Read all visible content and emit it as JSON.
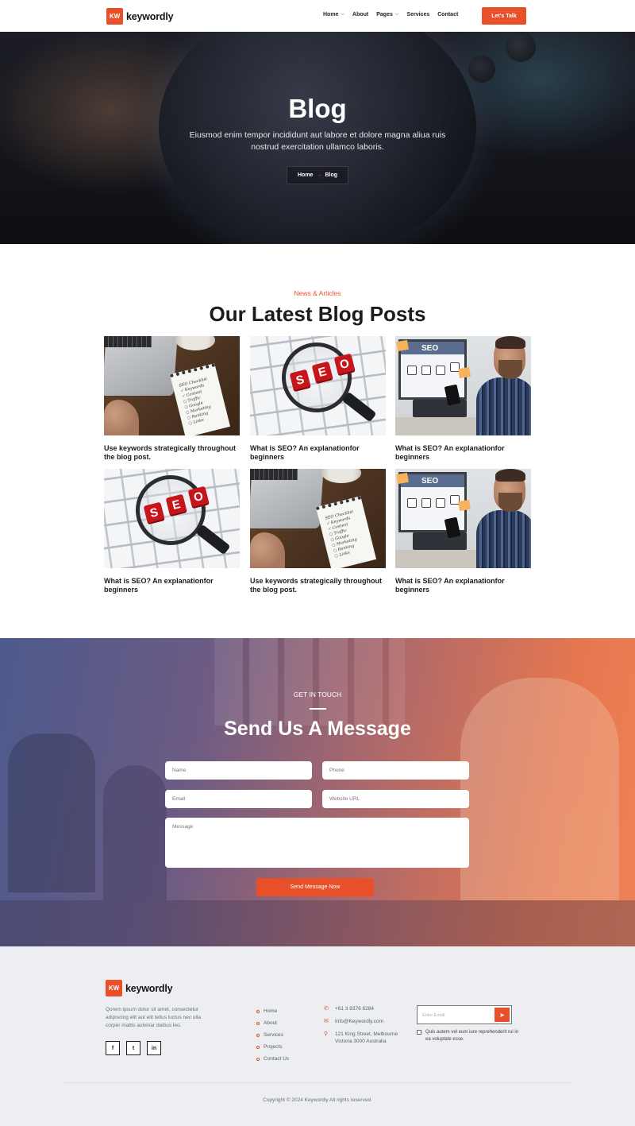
{
  "brand": {
    "mark": "KW",
    "name": "keywordly",
    "accent": "#e8502a"
  },
  "nav": {
    "items": [
      {
        "label": "Home",
        "dropdown": true
      },
      {
        "label": "About",
        "dropdown": false
      },
      {
        "label": "Pages",
        "dropdown": true
      },
      {
        "label": "Services",
        "dropdown": false
      },
      {
        "label": "Contact",
        "dropdown": false
      }
    ],
    "cta": "Let's Talk"
  },
  "hero": {
    "title": "Blog",
    "subtitle": "Eiusmod enim tempor incididunt aut labore et dolore magna aliua ruis nostrud exercitation ullamco laboris.",
    "breadcrumb": {
      "home": "Home",
      "arrow": "→",
      "current": "Blog"
    }
  },
  "blog": {
    "eyebrow": "News & Articles",
    "title": "Our Latest Blog Posts",
    "posts": [
      {
        "image": "laptop-checklist",
        "title": "Use keywords strategically throughout the blog post."
      },
      {
        "image": "seo-magnifier",
        "title": "What is SEO? An explanationfor beginners"
      },
      {
        "image": "man-seo-screen",
        "title": "What is SEO? An explanationfor beginners"
      },
      {
        "image": "seo-magnifier",
        "title": "What is SEO? An explanationfor beginners"
      },
      {
        "image": "laptop-checklist",
        "title": "Use keywords strategically throughout the blog post."
      },
      {
        "image": "man-seo-screen",
        "title": "What is SEO? An explanationfor beginners"
      }
    ],
    "image_text": {
      "seo_letters": [
        "S",
        "E",
        "O"
      ],
      "checklist": [
        "SEO Checklist",
        "✓ Keywords",
        "✓ Content",
        "○ Traffic",
        "○ Google",
        "○ Marketing",
        "○ Ranking",
        "○ Links"
      ],
      "screen_label": "SEO"
    }
  },
  "contact": {
    "eyebrow": "GET IN TOUCH",
    "title": "Send Us A Message",
    "fields": {
      "name": "Name",
      "phone": "Phone",
      "email": "Email",
      "website": "Website URL",
      "message": "Message"
    },
    "submit": "Send Message Now"
  },
  "footer": {
    "about": "Qorem ipsum dolor sit amet, consectetur adipiscing elit aut elit tellus luctus nec ulla corper mattis aulvinar daibus leo.",
    "socials": [
      {
        "icon": "facebook-icon",
        "glyph": "f"
      },
      {
        "icon": "twitter-icon",
        "glyph": "t"
      },
      {
        "icon": "linkedin-icon",
        "glyph": "in"
      }
    ],
    "links": [
      "Home",
      "About",
      "Services",
      "Projects",
      "Contact Us"
    ],
    "contact": {
      "phone": "+61 3 8376 6284",
      "email": "Info@Keywordly.com",
      "address": "121 King Street, Melbourne Victoria 3000 Australia"
    },
    "newsletter": {
      "placeholder": "Enter Email",
      "agree": "Quis autem vel eum iure reprehenderit rui in ea voluptate esse."
    },
    "copyright": "Copyright © 2024 Keywordly All rights reserved."
  }
}
